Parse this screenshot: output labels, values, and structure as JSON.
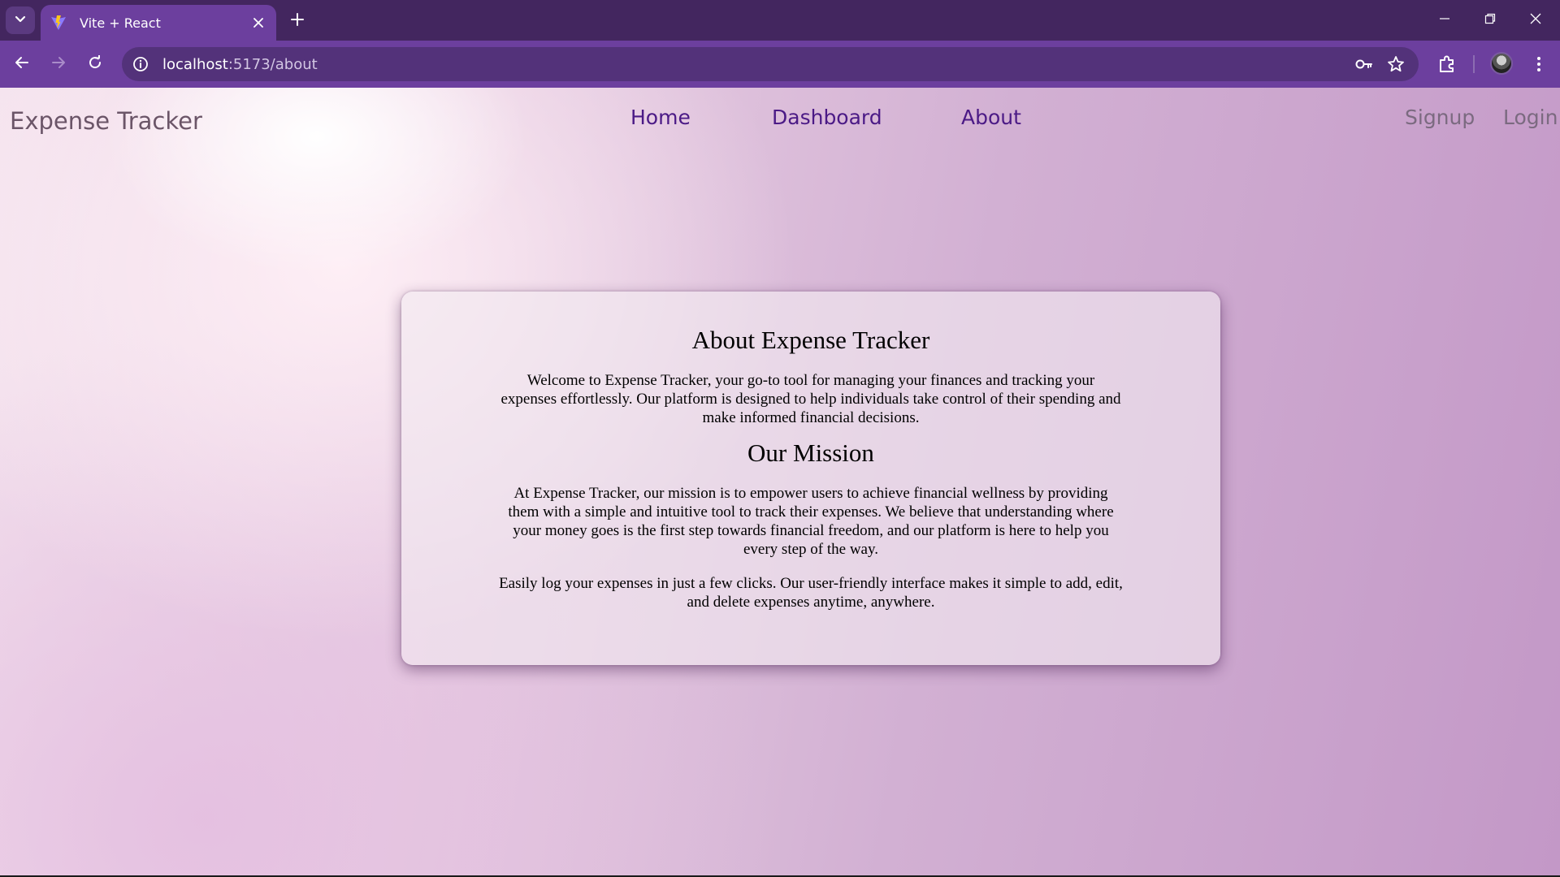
{
  "browser": {
    "tab_title": "Vite + React",
    "url_host": "localhost",
    "url_path": ":5173/about"
  },
  "icons": {
    "tab_list": "chevron-down-icon",
    "favicon": "vite-logo-icon",
    "tab_close": "close-icon",
    "new_tab": "plus-icon",
    "back": "arrow-left-icon",
    "forward": "arrow-right-icon",
    "reload": "reload-icon",
    "site_info": "info-icon",
    "password": "key-icon",
    "bookmark": "star-icon",
    "extensions": "puzzle-icon",
    "menu": "kebab-menu-icon"
  },
  "colors": {
    "chrome_frame": "#43265f",
    "chrome_toolbar": "#6c3f9e",
    "nav_link": "#4b1a86",
    "auth_link": "#7b6a80"
  },
  "navbar": {
    "brand": "Expense Tracker",
    "links": [
      "Home",
      "Dashboard",
      "About"
    ],
    "auth": [
      "Signup",
      "Login"
    ]
  },
  "about": {
    "title": "About Expense Tracker",
    "intro": "Welcome to Expense Tracker, your go-to tool for managing your finances and tracking your expenses effortlessly. Our platform is designed to help individuals take control of their spending and make informed financial decisions.",
    "mission_title": "Our Mission",
    "mission_text": "At Expense Tracker, our mission is to empower users to achieve financial wellness by providing them with a simple and intuitive tool to track their expenses. We believe that understanding where your money goes is the first step towards financial freedom, and our platform is here to help you every step of the way.",
    "extra_text": "Easily log your expenses in just a few clicks. Our user-friendly interface makes it simple to add, edit, and delete expenses anytime, anywhere."
  }
}
